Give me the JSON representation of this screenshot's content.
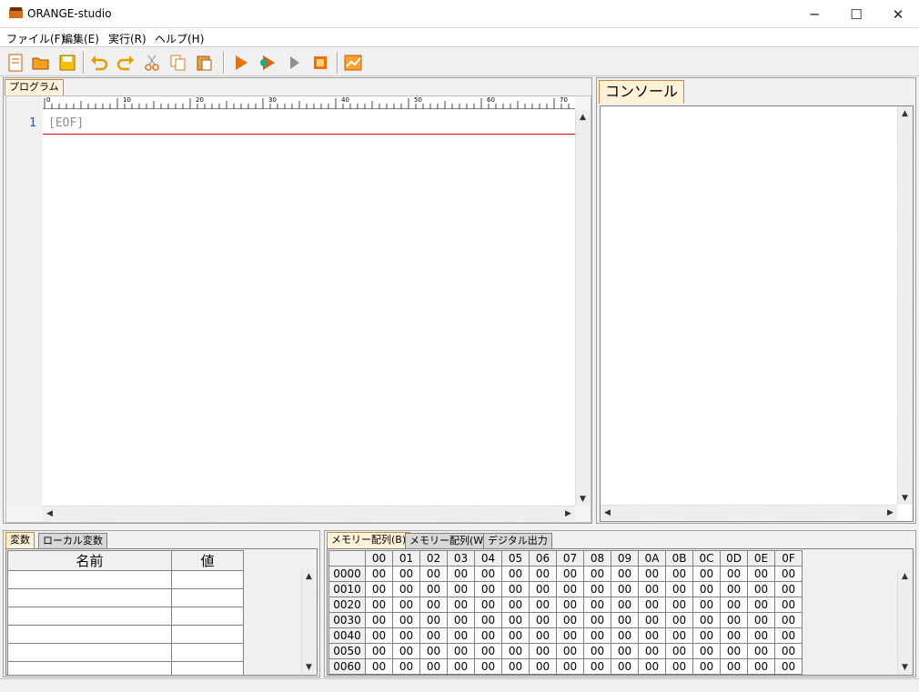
{
  "window": {
    "title": "ORANGE-studio"
  },
  "menu": [
    "ファイル(F)",
    "編集(E)",
    "実行(R)",
    "ヘルプ(H)"
  ],
  "toolbar": [
    "new",
    "open",
    "save",
    "undo",
    "redo",
    "cut",
    "copy",
    "paste",
    "run",
    "debug",
    "step",
    "stop",
    "graph"
  ],
  "program": {
    "tab": "プログラム",
    "ruler": [
      "0",
      "10",
      "20",
      "30",
      "40",
      "50",
      "60",
      "70"
    ],
    "line_no": "1",
    "eof": "[EOF]"
  },
  "console": {
    "tab": "コンソール"
  },
  "vars": {
    "tabs": [
      "変数",
      "ローカル変数"
    ],
    "headers": [
      "名前",
      "値"
    ]
  },
  "memory": {
    "tabs": [
      "メモリー配列(B)",
      "メモリー配列(W)",
      "デジタル出力"
    ],
    "cols": [
      "00",
      "01",
      "02",
      "03",
      "04",
      "05",
      "06",
      "07",
      "08",
      "09",
      "0A",
      "0B",
      "0C",
      "0D",
      "0E",
      "0F"
    ],
    "rows": [
      "0000",
      "0010",
      "0020",
      "0030",
      "0040",
      "0050",
      "0060"
    ],
    "cell": "00"
  }
}
